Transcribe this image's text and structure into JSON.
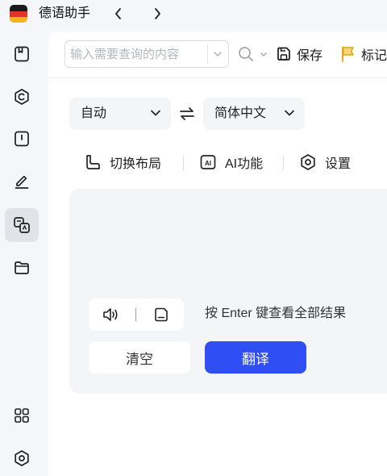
{
  "titlebar": {
    "app_title": "德语助手",
    "back_icon": "chevron-left-icon",
    "forward_icon": "chevron-right-icon",
    "logo_colors": [
      "#1a1a1a",
      "#e0322a",
      "#f2b51c"
    ]
  },
  "sidebar": {
    "items": [
      {
        "name": "dictionary",
        "icon": "book-icon",
        "active": false
      },
      {
        "name": "conjugation",
        "icon": "c-circle-icon",
        "active": false
      },
      {
        "name": "wordbook",
        "icon": "notebook-icon",
        "active": false
      },
      {
        "name": "notes",
        "icon": "pen-icon",
        "active": false
      },
      {
        "name": "translate",
        "icon": "translate-icon",
        "active": true
      },
      {
        "name": "files",
        "icon": "folder-icon",
        "active": false
      },
      {
        "name": "apps",
        "icon": "grid-icon",
        "active": false
      },
      {
        "name": "settings",
        "icon": "hexagon-settings-icon",
        "active": false
      }
    ]
  },
  "toolbar": {
    "search_placeholder": "输入需要查询的内容",
    "search_value": "",
    "save_label": "保存",
    "mark_label": "标记"
  },
  "translate": {
    "source_lang": "自动",
    "target_lang": "简体中文",
    "swap_icon": "swap-arrows-icon",
    "functions": {
      "layout_label": "切换布局",
      "ai_label": "AI功能",
      "settings_label": "设置"
    },
    "input_text": "",
    "hint": "按 Enter 键查看全部结果",
    "clear_label": "清空",
    "translate_label": "翻译"
  },
  "colors": {
    "accent": "#2f4ef4",
    "active_sidebar": "#e1e3e8",
    "panel": "#f4f5f7",
    "mark_flag": "#f2b51c"
  }
}
